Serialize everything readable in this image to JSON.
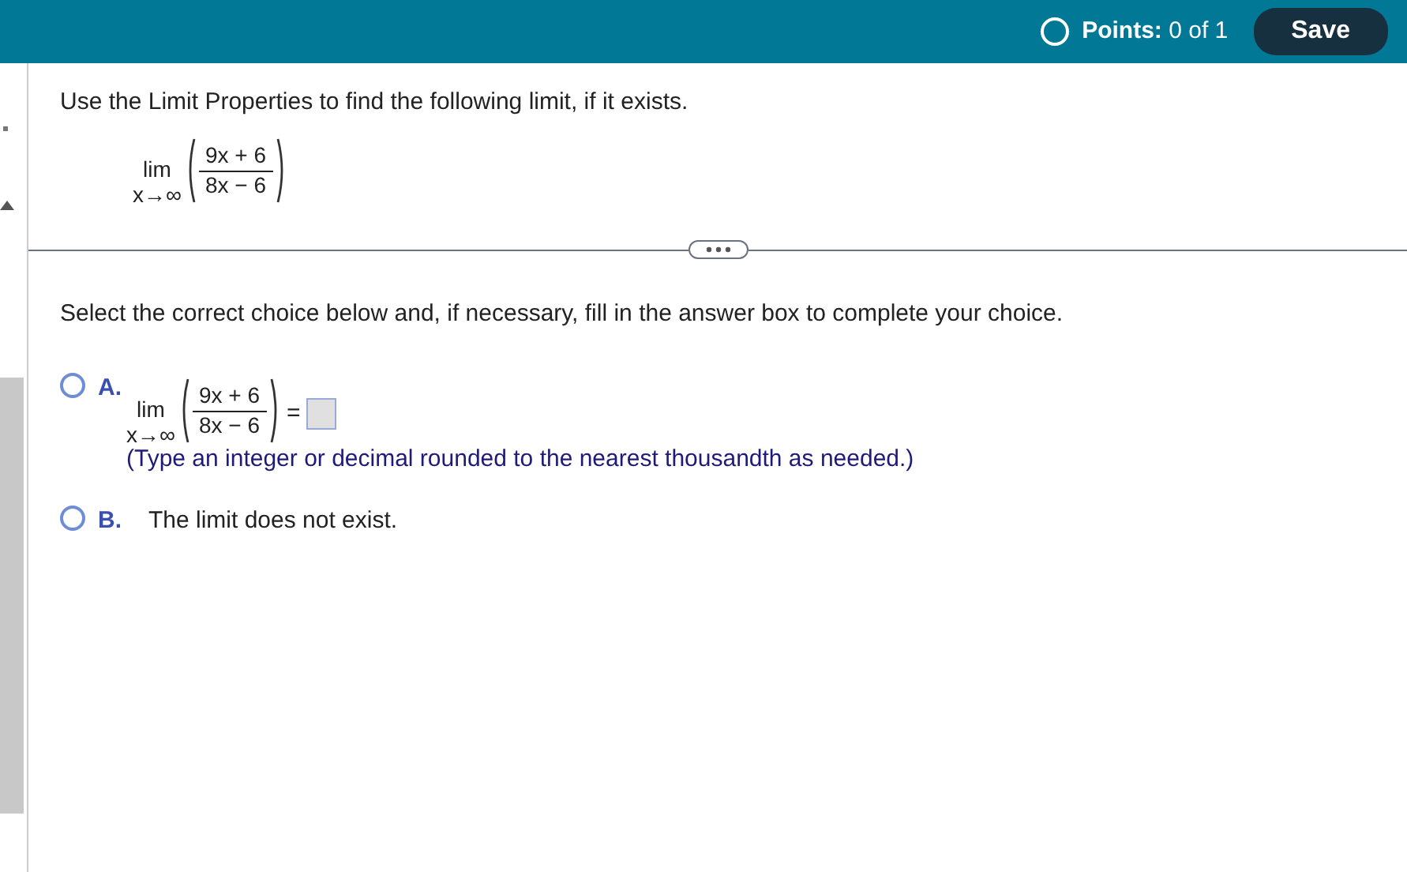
{
  "header": {
    "points_label": "Points:",
    "points_value": "0 of 1",
    "save_button": "Save"
  },
  "question": {
    "instruction": "Use the Limit Properties to find the following limit, if it exists.",
    "limit": {
      "lim": "lim",
      "sub": "x→∞",
      "numerator": "9x + 6",
      "denominator": "8x − 6"
    }
  },
  "prompt": "Select the correct choice below and, if necessary, fill in the answer box to complete your choice.",
  "choices": [
    {
      "letter": "A.",
      "kind": "limit-answer",
      "selected": false,
      "limit": {
        "lim": "lim",
        "sub": "x→∞",
        "numerator": "9x + 6",
        "denominator": "8x − 6"
      },
      "equals": "=",
      "hint": "(Type an integer or decimal rounded to the nearest thousandth as needed.)"
    },
    {
      "letter": "B.",
      "kind": "text",
      "selected": false,
      "text": "The limit does not exist."
    }
  ]
}
